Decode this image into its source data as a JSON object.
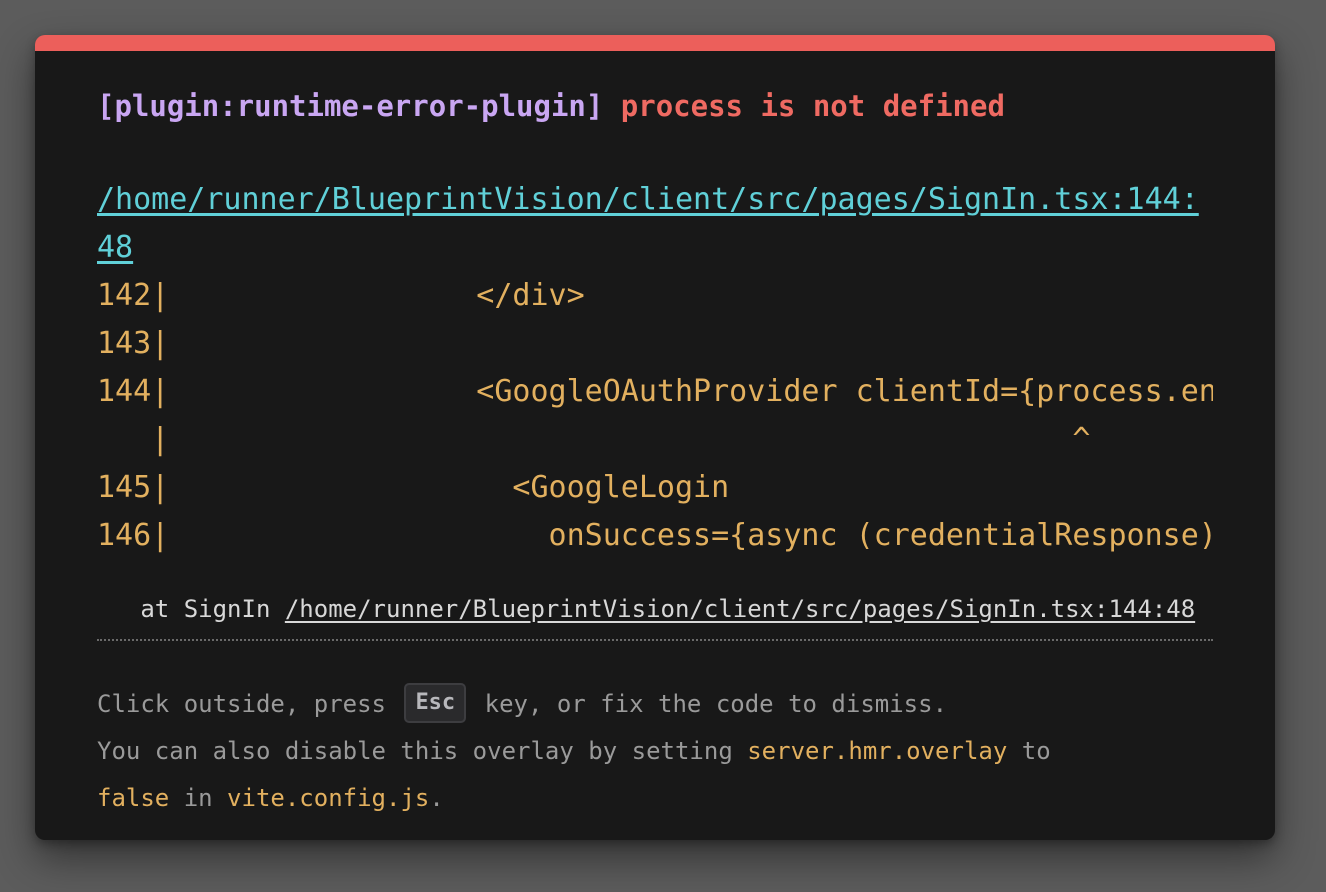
{
  "colors": {
    "backdrop": "#5c5c5c",
    "panel": "#181818",
    "accent_bar": "#ec5f5b",
    "plugin_text": "#c9a6f2",
    "error_text": "#ef6a62",
    "file_link": "#60d0d8",
    "code_text": "#e2b05f",
    "stack_text": "#d8d8d8",
    "tip_text": "#9a9a9a"
  },
  "error": {
    "plugin": "[plugin:runtime-error-plugin]",
    "message": "process is not defined",
    "file": "/home/runner/BlueprintVision/client/src/pages/SignIn.tsx:144:48"
  },
  "frame": {
    "lines": [
      {
        "gutter": "142|",
        "code": "                 </div>"
      },
      {
        "gutter": "143|",
        "code": ""
      },
      {
        "gutter": "144|",
        "code": "                 <GoogleOAuthProvider clientId={process.env.REACT_APP_GOOGLE_CLIENT_ID}>"
      },
      {
        "gutter": "   |",
        "code": "                                                  ^"
      },
      {
        "gutter": "145|",
        "code": "                   <GoogleLogin"
      },
      {
        "gutter": "146|",
        "code": "                     onSuccess={async (credentialResponse) => {"
      }
    ]
  },
  "stack": {
    "prefix": "   at SignIn ",
    "link": "/home/runner/BlueprintVision/client/src/pages/SignIn.tsx:144:48"
  },
  "tip": {
    "line1_before": "Click outside, press",
    "key": "Esc",
    "line1_after": "key, or fix the code to dismiss.",
    "line2_before": "You can also disable this overlay by setting ",
    "line2_code": "server.hmr.overlay",
    "line2_after": " to",
    "line3_code1": "false",
    "line3_mid": " in ",
    "line3_code2": "vite.config.js",
    "line3_end": "."
  }
}
